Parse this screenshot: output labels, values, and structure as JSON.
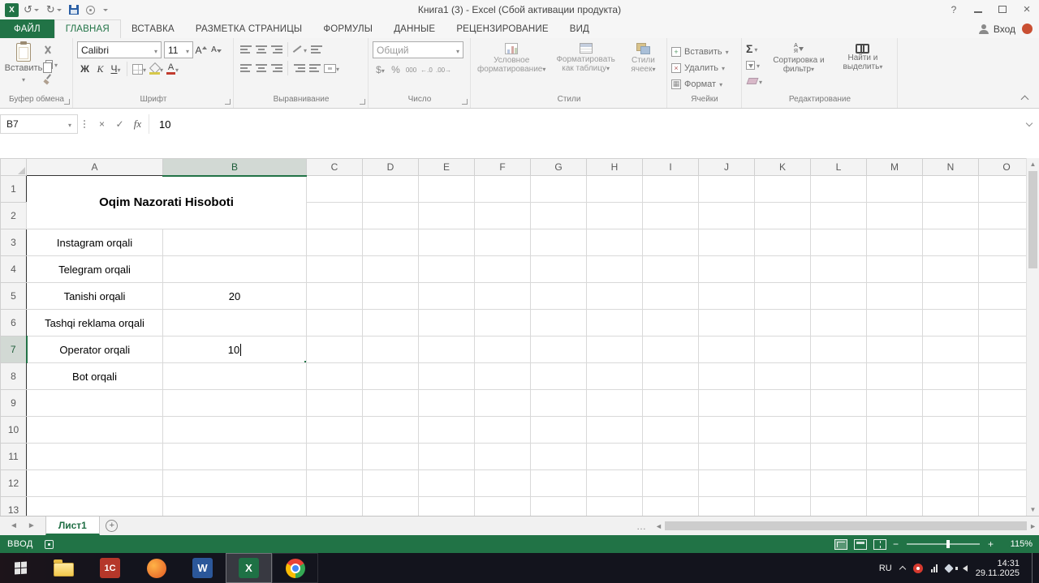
{
  "titlebar": {
    "title": "Книга1 (3) - Excel (Сбой активации продукта)"
  },
  "tabs": {
    "file": "ФАЙЛ",
    "items": [
      "ГЛАВНАЯ",
      "ВСТАВКА",
      "РАЗМЕТКА СТРАНИЦЫ",
      "ФОРМУЛЫ",
      "ДАННЫЕ",
      "РЕЦЕНЗИРОВАНИЕ",
      "ВИД"
    ],
    "active": "ГЛАВНАЯ",
    "signin": "Вход"
  },
  "ribbon": {
    "clipboard": {
      "paste": "Вставить",
      "label": "Буфер обмена"
    },
    "font": {
      "family": "Calibri",
      "size": "11",
      "bold": "Ж",
      "italic": "К",
      "underline": "Ч",
      "letter": "А",
      "label": "Шрифт"
    },
    "alignment": {
      "label": "Выравнивание"
    },
    "number": {
      "format": "Общий",
      "currency": "$",
      "percent": "%",
      "thousands": "000",
      "inc_decimal": "←.0",
      "dec_decimal": ".00→",
      "label": "Число"
    },
    "styles": {
      "conditional": "Условное форматирование",
      "as_table": "Форматировать как таблицу",
      "cell_styles": "Стили ячеек",
      "label": "Стили"
    },
    "cells": {
      "insert": "Вставить",
      "delete": "Удалить",
      "format": "Формат",
      "label": "Ячейки"
    },
    "editing": {
      "sort": "Сортировка и фильтр",
      "find": "Найти и выделить",
      "sort_a": "А",
      "sort_z": "Я",
      "label": "Редактирование"
    }
  },
  "formula_bar": {
    "name_box": "B7",
    "content": "10"
  },
  "grid": {
    "columns": [
      "A",
      "B",
      "C",
      "D",
      "E",
      "F",
      "G",
      "H",
      "I",
      "J",
      "K",
      "L",
      "M",
      "N",
      "O"
    ],
    "row_count": 13,
    "selected_column": "B",
    "selected_row": 7,
    "merged_title": "Oqim Nazorati Hisoboti",
    "merged_range": {
      "cols": [
        "A",
        "B"
      ],
      "row_start": 1,
      "row_end": 2
    },
    "boxed_range": {
      "cols": [
        "A",
        "B"
      ],
      "row_start": 3,
      "row_end": 13
    },
    "edit_cell": "B7",
    "cells": {
      "A3": "Instagram orqali",
      "A4": "Telegram orqali",
      "A5": "Tanishi orqali",
      "B5": "20",
      "A6": "Tashqi reklama orqali",
      "A7": "Operator orqali",
      "B7": "10",
      "A8": "Bot orqali"
    }
  },
  "sheet_bar": {
    "tabs": [
      "Лист1"
    ],
    "active": "Лист1"
  },
  "status_bar": {
    "mode": "ВВОД",
    "zoom": "115%"
  },
  "taskbar": {
    "app_labels": {
      "onec": "1С",
      "word": "W",
      "excel": "X"
    },
    "active_app": "excel",
    "tray": {
      "lang": "RU",
      "time": "14:31",
      "date": "29.11.2025"
    }
  },
  "icons": {
    "undo": "↺",
    "redo": "↻",
    "help": "?",
    "cancel": "×",
    "check": "✓",
    "fx": "fx",
    "sum": "Σ",
    "left": "◄",
    "right": "►",
    "up": "▲",
    "down": "▼",
    "ellipsis": "…",
    "plus": "+",
    "minus": "−"
  }
}
